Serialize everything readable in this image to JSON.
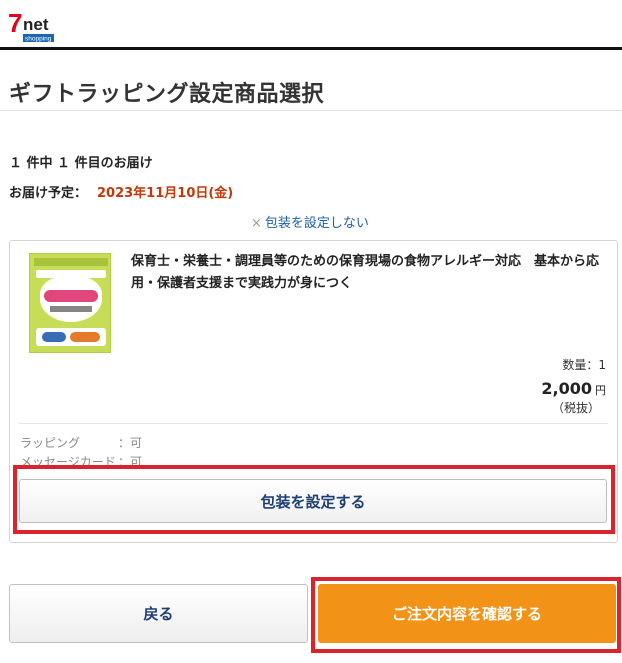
{
  "header": {
    "logo_alt": "7net shopping",
    "brand_colors": {
      "seven": "#e2001a",
      "net": "#222222",
      "shopping_bg": "#1a66b3"
    }
  },
  "page": {
    "title": "ギフトラッピング設定商品選択",
    "count_text": "１ 件中 １ 件目のお届け",
    "delivery_label": "お届け予定：",
    "delivery_date": "2023年11月10日(金)",
    "no_wrap_link": "包装を設定しない",
    "no_wrap_icon": "×"
  },
  "product": {
    "image_icon": "book-cover-image",
    "title": "保育士・栄養士・調理員等のための保育現場の食物アレルギー対応　基本から応用・保護者支援まで実践力が身につく",
    "quantity_text": "数量：1",
    "price": "2,000",
    "price_unit": "円",
    "tax_note": "（税抜）",
    "options": [
      {
        "label": "ラッピング",
        "value": "：可"
      },
      {
        "label": "メッセージカード",
        "value": "：可"
      }
    ],
    "wrap_button": "包装を設定する"
  },
  "footer": {
    "back_button": "戻る",
    "confirm_button": "ご注文内容を確認する"
  },
  "colors": {
    "accent_orange": "#f29317",
    "date_red": "#c0390b",
    "link_blue": "#1f5fa8",
    "highlight_red": "#d9232d",
    "button_text_navy": "#1e3f73"
  }
}
